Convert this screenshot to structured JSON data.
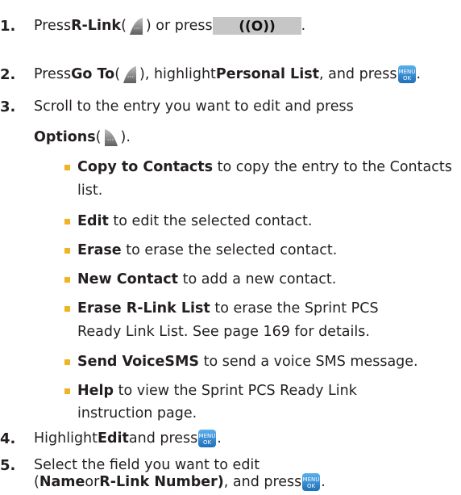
{
  "step1": {
    "num": "1.",
    "a": "Press ",
    "b": "R-Link",
    "c": " (",
    "d": ") or press ",
    "e": "."
  },
  "step2": {
    "num": "2.",
    "a": "Press ",
    "b": "Go To",
    "c": " (",
    "d": "), highlight ",
    "e": "Personal List",
    "f": ", and press ",
    "g": "."
  },
  "step3": {
    "num": "3.",
    "line1": "Scroll to the entry you want to edit and press",
    "b": "Options",
    "c": " (",
    "d": ")."
  },
  "options": [
    {
      "bold": "Copy to Contacts",
      "rest": " to copy the entry to the Contacts",
      "cont": "list."
    },
    {
      "bold": "Edit",
      "rest": " to edit the selected contact."
    },
    {
      "bold": "Erase",
      "rest": " to erase the selected contact."
    },
    {
      "bold": "New Contact",
      "rest": " to add a new contact."
    },
    {
      "bold": "Erase R-Link List",
      "rest": " to erase the Sprint PCS",
      "cont": "Ready Link List. See page 169 for details."
    },
    {
      "bold": "Send VoiceSMS",
      "rest": " to send a voice SMS message."
    },
    {
      "bold": "Help",
      "rest": " to view the Sprint PCS Ready Link",
      "cont": "instruction page."
    }
  ],
  "step4": {
    "num": "4.",
    "a": "Highlight ",
    "b": "Edit",
    "c": " and press ",
    "d": "."
  },
  "step5": {
    "num": "5.",
    "line1": "Select the field you want to edit",
    "a": "(",
    "b": "Name",
    "c": " or ",
    "d": "R-Link Number)",
    "e": ", and press ",
    "f": "."
  },
  "icons": {
    "softkey_left": "left-softkey-icon",
    "softkey_right": "right-softkey-icon",
    "nav": "navigation-key-icon",
    "menu_ok": "menu-ok-key-icon",
    "menu_ok_label_top": "MENU",
    "menu_ok_label_bottom": "OK",
    "colors": {
      "bullet": "#f0b323",
      "key_blue": "#2a7fc7",
      "key_gray": "#7f7f7f"
    }
  }
}
